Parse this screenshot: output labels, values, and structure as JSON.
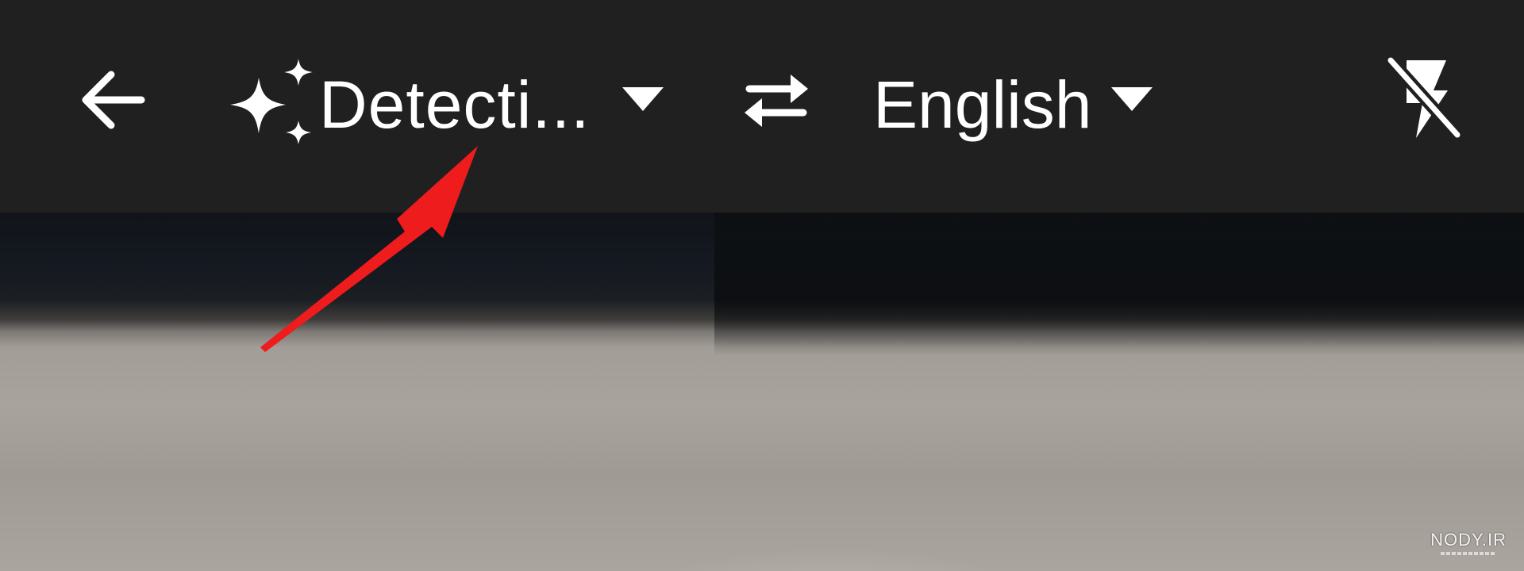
{
  "toolbar": {
    "back": {
      "icon": "back-arrow-icon"
    },
    "source_language": {
      "icon": "sparkle-icon",
      "label": "Detecti...",
      "caret_icon": "dropdown-caret-icon"
    },
    "swap": {
      "icon": "swap-arrows-icon"
    },
    "target_language": {
      "label": "English",
      "caret_icon": "dropdown-caret-icon"
    },
    "flash": {
      "icon": "flash-off-icon"
    }
  },
  "annotation": {
    "icon": "red-arrow-pointer-icon",
    "color": "#ee1c1c"
  },
  "watermark": {
    "text": "NODY.IR"
  },
  "colors": {
    "toolbar_bg": "#202020",
    "foreground": "#ffffff"
  }
}
